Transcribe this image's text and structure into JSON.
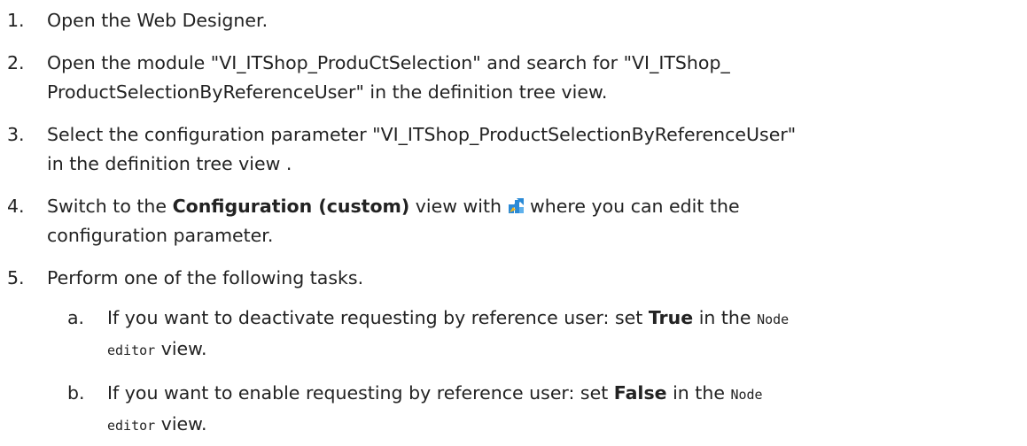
{
  "steps": [
    {
      "num": "1.",
      "lines": [
        "Open the Web Designer."
      ]
    },
    {
      "num": "2.",
      "lines": [
        "Open the module \"VI_ITShop_ProduCtSelection\" and search for \"VI_ITShop_",
        "ProductSelectionByReferenceUser\" in the definition tree view."
      ]
    },
    {
      "num": "3.",
      "lines": [
        "Select the configuration parameter \"VI_ITShop_ProductSelectionByReferenceUser\"",
        "in the definition tree view ."
      ]
    },
    {
      "num": "4.",
      "pre": "Switch to the ",
      "bold": "Configuration (custom)",
      "mid": " view with ",
      "post": " where you can edit the",
      "line2": "configuration parameter.",
      "icon": "configuration-custom-icon"
    },
    {
      "num": "5.",
      "lines": [
        "Perform one of the following tasks."
      ],
      "sub": [
        {
          "letter": "a.",
          "pre": "If you want to deactivate requesting by reference user: set ",
          "bold": "True",
          "mid": " in the ",
          "code1": "Node",
          "code2": "editor",
          "post": " view."
        },
        {
          "letter": "b.",
          "pre": "If you want to enable requesting by reference user: set ",
          "bold": "False",
          "mid": " in the ",
          "code1": "Node",
          "code2": "editor",
          "post": " view."
        }
      ]
    }
  ],
  "colors": {
    "text": "#222222",
    "icon_primary": "#2a8ad6",
    "icon_secondary": "#f2b51c"
  }
}
